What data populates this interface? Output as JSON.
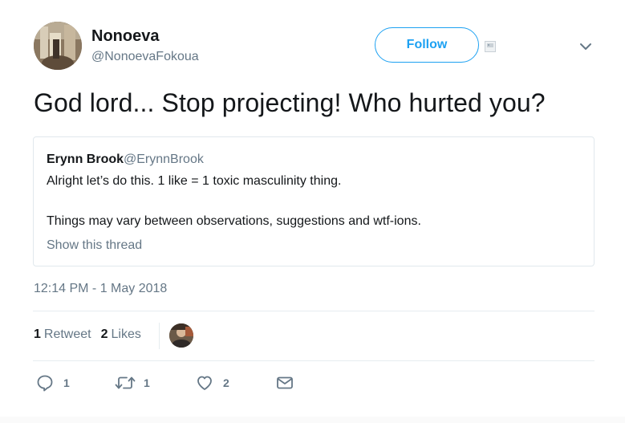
{
  "author": {
    "fullname": "Nonoeva",
    "screenname": "@NonoevaFokoua"
  },
  "follow_button": {
    "label": "Follow"
  },
  "tweet": {
    "text": "God lord... Stop projecting! Who hurted you?",
    "timestamp": "12:14 PM - 1 May 2018"
  },
  "quoted_tweet": {
    "fullname": "Erynn Brook",
    "screenname": "@ErynnBrook",
    "line1": "Alright let’s do this. 1 like = 1 toxic masculinity thing.",
    "line2": "Things may vary between observations, suggestions and wtf-ions.",
    "show_thread": "Show this thread"
  },
  "stats": {
    "retweets_count": "1",
    "retweets_label": "Retweet",
    "likes_count": "2",
    "likes_label": "Likes"
  },
  "actions": {
    "reply_count": "1",
    "retweet_count": "1",
    "like_count": "2"
  },
  "icons": {
    "reply": "reply-icon",
    "retweet": "retweet-icon",
    "like": "heart-icon",
    "dm": "envelope-icon",
    "caret": "chevron-down-icon"
  },
  "colors": {
    "accent": "#1da1f2",
    "text": "#14171a",
    "secondary": "#657786",
    "border": "#e1e8ed"
  }
}
